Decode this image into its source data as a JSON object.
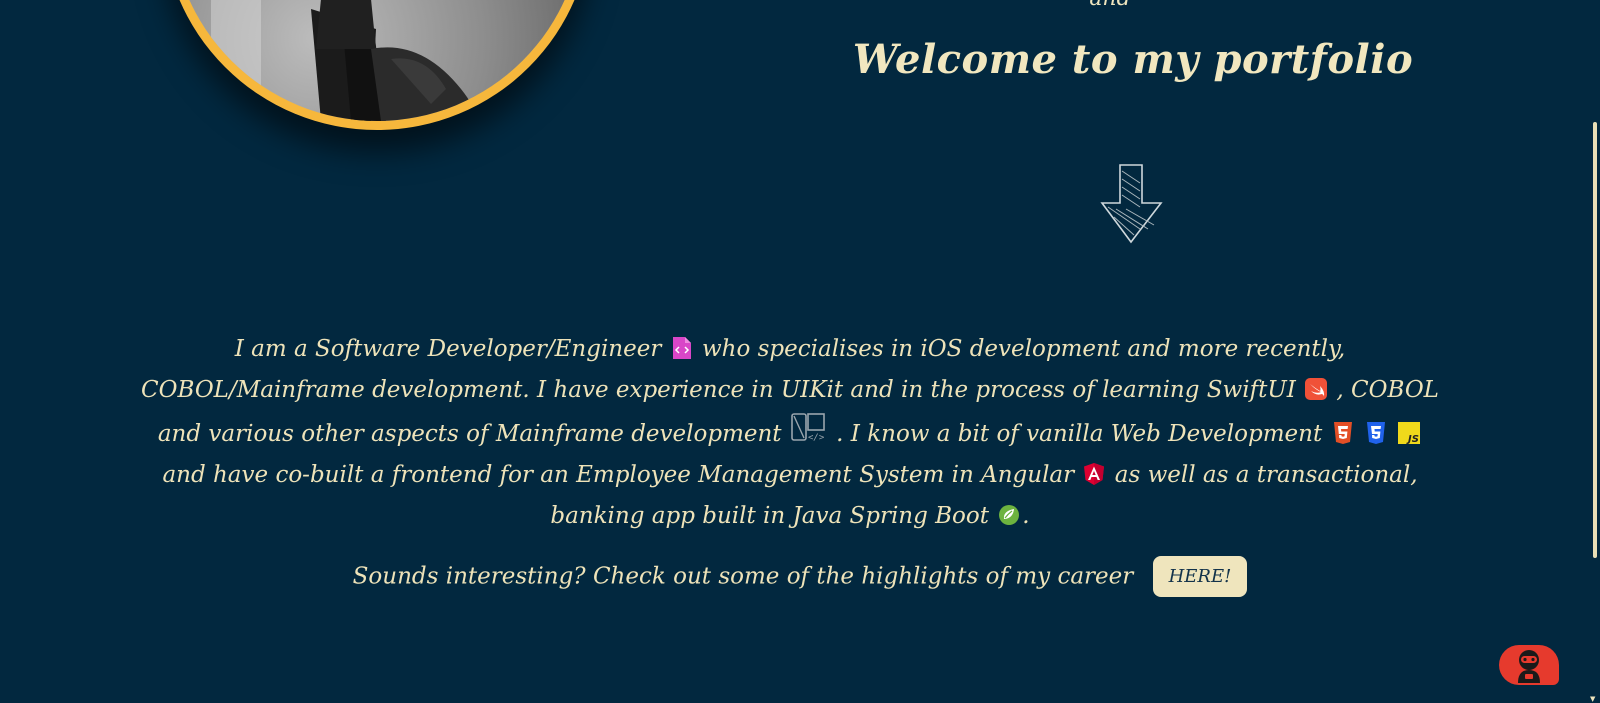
{
  "header": {
    "and_text": "and",
    "welcome": "Welcome to my portfolio"
  },
  "bio": {
    "p1": "I am a Software Developer/Engineer",
    "p2": "who specialises in iOS development and more recently, COBOL/Mainframe development. I have experience in UIKit and in the process of learning SwiftUI",
    "p3": ", COBOL and various other aspects of Mainframe development",
    "p4": ". I know a bit of vanilla Web Development",
    "p5": "and have co-built a frontend for an Employee Management System in Angular",
    "p6": "as well as a transactional, banking app built in Java Spring Boot",
    "p7": "."
  },
  "cta": {
    "text": "Sounds interesting? Check out some of the highlights of my career",
    "button": "HERE!"
  },
  "icons": {
    "code_file": "code-file-icon",
    "swift": "swift-icon",
    "mainframe": "mainframe-code-icon",
    "html5": "html5-icon",
    "css3": "css3-icon",
    "js": "javascript-icon",
    "angular": "angular-icon",
    "spring": "spring-boot-icon",
    "js_label": "JS"
  },
  "colors": {
    "background": "#02283f",
    "text": "#eee3b9",
    "accent_ring": "#f6b73c",
    "chat_button": "#e63a2d"
  }
}
